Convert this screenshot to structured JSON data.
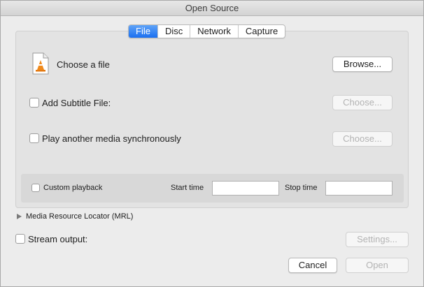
{
  "window": {
    "title": "Open Source"
  },
  "tabs": [
    {
      "label": "File",
      "active": true
    },
    {
      "label": "Disc",
      "active": false
    },
    {
      "label": "Network",
      "active": false
    },
    {
      "label": "Capture",
      "active": false
    }
  ],
  "file": {
    "icon": "vlc-cone-document-icon",
    "choose_label": "Choose a file",
    "browse_button": "Browse..."
  },
  "subtitle": {
    "checkbox_label": "Add Subtitle File:",
    "checked": false,
    "choose_button": "Choose..."
  },
  "sync_media": {
    "checkbox_label": "Play another media synchronously",
    "checked": false,
    "choose_button": "Choose..."
  },
  "playback": {
    "custom_label": "Custom playback",
    "checked": false,
    "start_time_label": "Start time",
    "start_time_value": "",
    "stop_time_label": "Stop time",
    "stop_time_value": ""
  },
  "mrl": {
    "label": "Media Resource Locator (MRL)",
    "icon": "disclosure-triangle-icon"
  },
  "stream_output": {
    "checkbox_label": "Stream output:",
    "checked": false,
    "settings_button": "Settings..."
  },
  "footer": {
    "cancel_button": "Cancel",
    "open_button": "Open"
  },
  "colors": {
    "accent": "#1a6ff0",
    "disabled_text": "#b3b3b3"
  }
}
